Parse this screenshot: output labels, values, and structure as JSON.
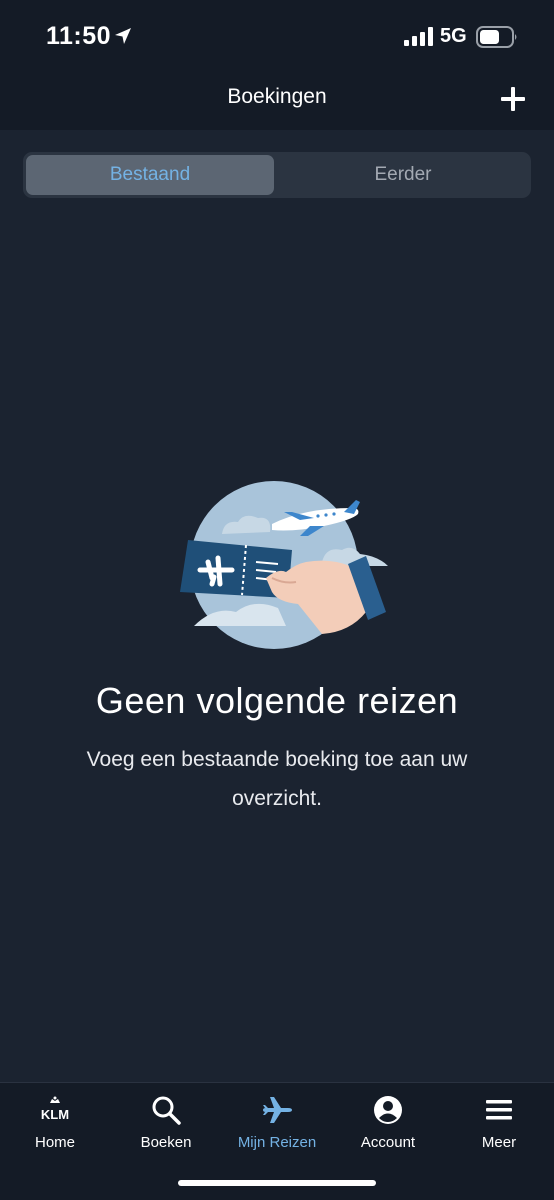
{
  "status_bar": {
    "time": "11:50",
    "network": "5G"
  },
  "header": {
    "title": "Boekingen",
    "add_icon": "plus-icon"
  },
  "segments": {
    "options": [
      {
        "label": "Bestaand",
        "selected": true
      },
      {
        "label": "Eerder",
        "selected": false
      }
    ]
  },
  "empty_state": {
    "title": "Geen volgende reizen",
    "message": "Voeg een bestaande boeking toe aan uw overzicht.",
    "illustration": "hand-holding-ticket-illustration"
  },
  "tabbar": {
    "items": [
      {
        "label": "Home",
        "icon": "klm-logo-icon",
        "active": false
      },
      {
        "label": "Boeken",
        "icon": "search-icon",
        "active": false
      },
      {
        "label": "Mijn Reizen",
        "icon": "airplane-icon",
        "active": true
      },
      {
        "label": "Account",
        "icon": "account-icon",
        "active": false
      },
      {
        "label": "Meer",
        "icon": "menu-icon",
        "active": false
      }
    ]
  },
  "colors": {
    "background": "#1b2330",
    "bar_background": "#141b26",
    "accent": "#74b2e4",
    "segment_selected": "#5c6673"
  }
}
